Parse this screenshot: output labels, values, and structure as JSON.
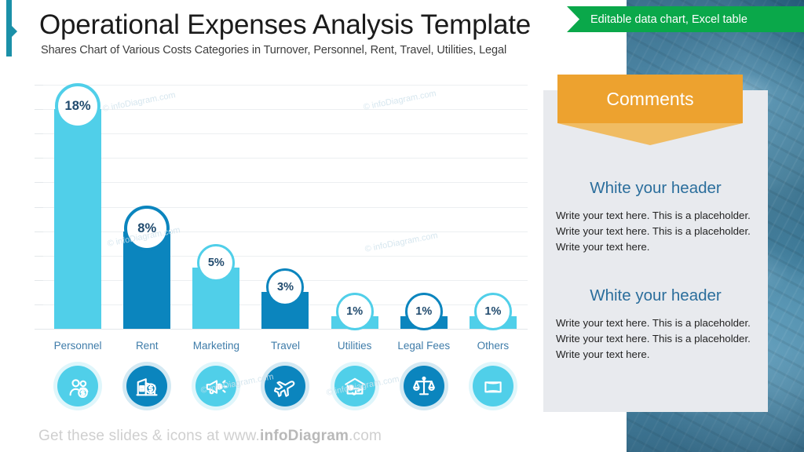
{
  "header": {
    "title": "Operational Expenses Analysis Template",
    "subtitle": "Shares Chart of Various Costs Categories in Turnover, Personnel, Rent, Travel, Utilities, Legal"
  },
  "ribbon": {
    "label": "Editable data chart, Excel table",
    "color": "#0aa84a"
  },
  "comments": {
    "banner_label": "Comments",
    "banner_color": "#eda22f",
    "panel_color": "#e8eaee",
    "blocks": [
      {
        "header": "White your header",
        "body": "Write your text here. This is a placeholder.  Write your text here. This is a placeholder.  Write your text here."
      },
      {
        "header": "White your header",
        "body": "Write your text here. This is a placeholder.  Write your text here. This is a placeholder.  Write your text here."
      }
    ]
  },
  "footer": {
    "prefix": "Get these slides & icons at www.",
    "brand": "infoDiagram",
    "suffix": ".com"
  },
  "watermark": {
    "text": "© infoDiagram.com"
  },
  "chart_data": {
    "type": "bar",
    "title": "Operational Expenses Analysis Template",
    "subtitle": "Shares Chart of Various Costs Categories in Turnover, Personnel, Rent, Travel, Utilities, Legal",
    "xlabel": "",
    "ylabel": "",
    "ylim": [
      0,
      20
    ],
    "grid": true,
    "gridline_count": 10,
    "legend": "none",
    "unit": "%",
    "categories": [
      "Personnel",
      "Rent",
      "Marketing",
      "Travel",
      "Utilities",
      "Legal Fees",
      "Others"
    ],
    "values": [
      18,
      8,
      5,
      3,
      1,
      1,
      1
    ],
    "labels": [
      "18%",
      "8%",
      "5%",
      "3%",
      "1%",
      "1%",
      "1%"
    ],
    "colors": [
      "#50cfe9",
      "#0b85be",
      "#50cfe9",
      "#0b85be",
      "#50cfe9",
      "#0b85be",
      "#50cfe9"
    ],
    "icons": [
      "people-money-icon",
      "building-money-icon",
      "megaphone-money-icon",
      "airplane-icon",
      "house-faucet-money-icon",
      "scales-justice-icon",
      "document-icon"
    ]
  },
  "colors": {
    "light_blue": "#50cfe9",
    "dark_blue": "#0b85be",
    "accent_teal": "#1b90a8",
    "label_blue": "#3f7ca9",
    "bubble_text": "#214b6e",
    "heading_blue": "#2b6e9c"
  }
}
